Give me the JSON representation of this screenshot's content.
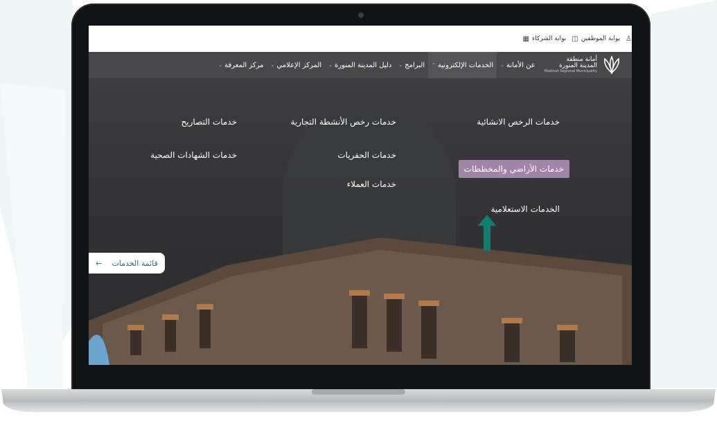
{
  "topbar": {
    "links": [
      {
        "label": "بوابة الشركاء",
        "icon": "building-icon"
      },
      {
        "label": "بوابة الموظفين",
        "icon": "id-card-icon"
      },
      {
        "label": "",
        "icon": "user-icon"
      }
    ]
  },
  "logo": {
    "line1": "أمانة منطقة",
    "line2": "المدينة المنورة",
    "line3": "Madinah Regional Municipality"
  },
  "nav": {
    "items": [
      {
        "label": "عن الأمانة",
        "dropdown": true,
        "active": false
      },
      {
        "label": "الخدمات الإلكترونية",
        "dropdown": true,
        "active": true
      },
      {
        "label": "البرامج",
        "dropdown": true,
        "active": false
      },
      {
        "label": "دليل المدينة المنورة",
        "dropdown": true,
        "active": false
      },
      {
        "label": "المركز الإعلامي",
        "dropdown": true,
        "active": false
      },
      {
        "label": "مركز المعرفة",
        "dropdown": true,
        "active": false
      }
    ]
  },
  "services": {
    "col1": [
      "خدمات الرخص الانشائية",
      "خدمات الأراضي والمخططات",
      "الخدمات الاستعلامية"
    ],
    "col2": [
      "خدمات رخص الأنشطة التجارية",
      "خدمات الحفريات",
      "خدمات العملاء"
    ],
    "col3": [
      "خدمات التصاريح",
      "خدمات الشهادات الصحية"
    ],
    "highlighted": "خدمات الأراضي والمخططات"
  },
  "services_menu": {
    "label": "قائمة الخدمات",
    "icon": "arrow-left-icon"
  },
  "colors": {
    "highlight": "#a085a8",
    "arrow": "#0f7f6e",
    "navbar": "#48474a",
    "button_text": "#2a6f73"
  }
}
